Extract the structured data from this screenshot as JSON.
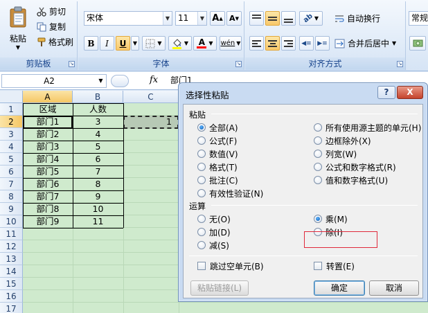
{
  "ribbon": {
    "clipboard": {
      "label": "剪贴板",
      "paste": "粘贴",
      "cut": "剪切",
      "copy": "复制",
      "format_painter": "格式刷"
    },
    "font": {
      "label": "字体",
      "font_name": "宋体",
      "font_size": "11",
      "grow": "A",
      "shrink": "A",
      "bold": "B",
      "italic": "I",
      "underline": "U",
      "font_color_letter": "A",
      "phonetic": "wén"
    },
    "alignment": {
      "label": "对齐方式",
      "wrap_text": "自动换行",
      "merge_center": "合并后居中"
    },
    "number": {
      "format": "常规"
    }
  },
  "formula_bar": {
    "name_box": "A2",
    "fx": "fx",
    "value": "部门1"
  },
  "sheet": {
    "columns": [
      "A",
      "B",
      "C"
    ],
    "rows": [
      "1",
      "2",
      "3",
      "4",
      "5",
      "6",
      "7",
      "8",
      "9",
      "10",
      "11",
      "12",
      "13",
      "14",
      "15",
      "16",
      "17"
    ],
    "header": [
      "区域",
      "人数"
    ],
    "data": [
      [
        "部门1",
        "3"
      ],
      [
        "部门2",
        "4"
      ],
      [
        "部门3",
        "5"
      ],
      [
        "部门4",
        "6"
      ],
      [
        "部门5",
        "7"
      ],
      [
        "部门6",
        "8"
      ],
      [
        "部门7",
        "9"
      ],
      [
        "部门8",
        "10"
      ],
      [
        "部门9",
        "11"
      ]
    ],
    "copied_value": "1"
  },
  "dialog": {
    "title": "选择性粘贴",
    "help": "?",
    "close": "X",
    "paste_section": "粘贴",
    "paste_options_left": [
      "全部(A)",
      "公式(F)",
      "数值(V)",
      "格式(T)",
      "批注(C)",
      "有效性验证(N)"
    ],
    "paste_options_right": [
      "所有使用源主题的单元(H)",
      "边框除外(X)",
      "列宽(W)",
      "公式和数字格式(R)",
      "值和数字格式(U)"
    ],
    "operation_section": "运算",
    "operation_left": [
      "无(O)",
      "加(D)",
      "减(S)"
    ],
    "operation_right": [
      "乘(M)",
      "除(I)"
    ],
    "skip_blanks": "跳过空单元(B)",
    "transpose": "转置(E)",
    "paste_link": "粘贴链接(L)",
    "ok": "确定",
    "cancel": "取消"
  },
  "colors": {
    "sheet_bg": "#cfeacd",
    "dialog_border": "#6f8fb9",
    "highlight": "#e0283a"
  }
}
